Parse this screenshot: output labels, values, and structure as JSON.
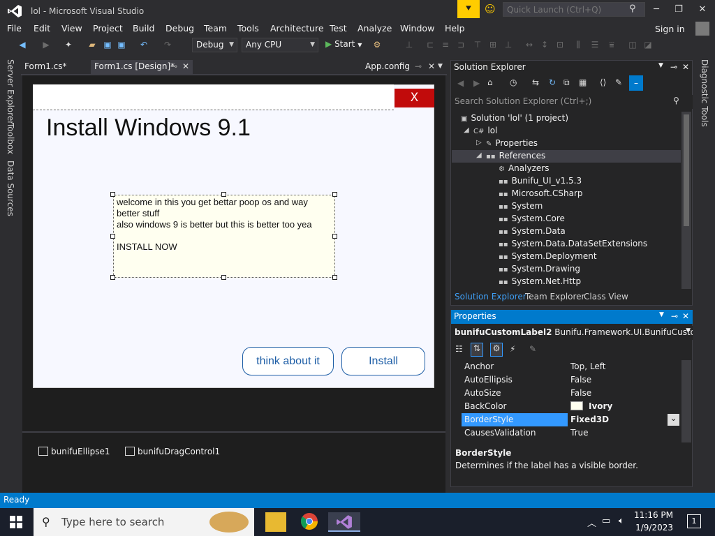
{
  "window": {
    "title": "lol - Microsoft Visual Studio",
    "quick_launch_placeholder": "Quick Launch (Ctrl+Q)"
  },
  "menu": [
    "File",
    "Edit",
    "View",
    "Project",
    "Build",
    "Debug",
    "Team",
    "Tools",
    "Architecture",
    "Test",
    "Analyze",
    "Window",
    "Help"
  ],
  "signin_label": "Sign in",
  "toolbar": {
    "config": "Debug",
    "platform": "Any CPU",
    "start_label": "Start"
  },
  "left_strip": [
    "Server Explorer",
    "Toolbox",
    "Data Sources"
  ],
  "right_strip": [
    "Diagnostic Tools"
  ],
  "doc_tabs": [
    "Form1.cs*",
    "Form1.cs [Design]*",
    "App.config"
  ],
  "form": {
    "close_label": "X",
    "title": "Install Windows 9.1",
    "label_lines": [
      "welcome in this you get bettar poop os and way better stuff",
      "also windows 9 is better but this is better too yea",
      "",
      "INSTALL NOW"
    ],
    "button_secondary": "think about it",
    "button_primary": "Install"
  },
  "tray_components": [
    "bunifuEllipse1",
    "bunifuDragControl1"
  ],
  "solution_explorer": {
    "title": "Solution Explorer",
    "search_placeholder": "Search Solution Explorer (Ctrl+;)",
    "tree": [
      {
        "label": "Solution 'lol' (1 project)",
        "icon": "solution-icon",
        "indent": 0
      },
      {
        "label": "lol",
        "icon": "csharp-project-icon",
        "indent": 1
      },
      {
        "label": "Properties",
        "icon": "wrench-icon",
        "indent": 2
      },
      {
        "label": "References",
        "icon": "references-icon",
        "indent": 2
      },
      {
        "label": "Analyzers",
        "icon": "analyzers-icon",
        "indent": 3
      },
      {
        "label": "Bunifu_UI_v1.5.3",
        "icon": "reference-icon",
        "indent": 3
      },
      {
        "label": "Microsoft.CSharp",
        "icon": "reference-icon",
        "indent": 3
      },
      {
        "label": "System",
        "icon": "reference-icon",
        "indent": 3
      },
      {
        "label": "System.Core",
        "icon": "reference-icon",
        "indent": 3
      },
      {
        "label": "System.Data",
        "icon": "reference-icon",
        "indent": 3
      },
      {
        "label": "System.Data.DataSetExtensions",
        "icon": "reference-icon",
        "indent": 3
      },
      {
        "label": "System.Deployment",
        "icon": "reference-icon",
        "indent": 3
      },
      {
        "label": "System.Drawing",
        "icon": "reference-icon",
        "indent": 3
      },
      {
        "label": "System.Net.Http",
        "icon": "reference-icon",
        "indent": 3
      }
    ],
    "bottom_tabs": [
      "Solution Explorer",
      "Team Explorer",
      "Class View"
    ]
  },
  "properties": {
    "title": "Properties",
    "object_name": "bunifuCustomLabel2",
    "object_type": "Bunifu.Framework.UI.BunifuCustomLal",
    "rows": [
      {
        "name": "Anchor",
        "value": "Top, Left"
      },
      {
        "name": "AutoEllipsis",
        "value": "False"
      },
      {
        "name": "AutoSize",
        "value": "False"
      },
      {
        "name": "BackColor",
        "value": "Ivory"
      },
      {
        "name": "BorderStyle",
        "value": "Fixed3D"
      },
      {
        "name": "CausesValidation",
        "value": "True"
      }
    ],
    "desc_title": "BorderStyle",
    "desc_text": "Determines if the label has a visible border."
  },
  "status": "Ready",
  "taskbar": {
    "search_placeholder": "Type here to search",
    "time": "11:16 PM",
    "date": "1/9/2023",
    "notification_count": "1"
  },
  "colors": {
    "accent": "#007acc",
    "form_close": "#c10b0b",
    "form_button": "#1e5ea6",
    "label_back": "#fffff0"
  }
}
